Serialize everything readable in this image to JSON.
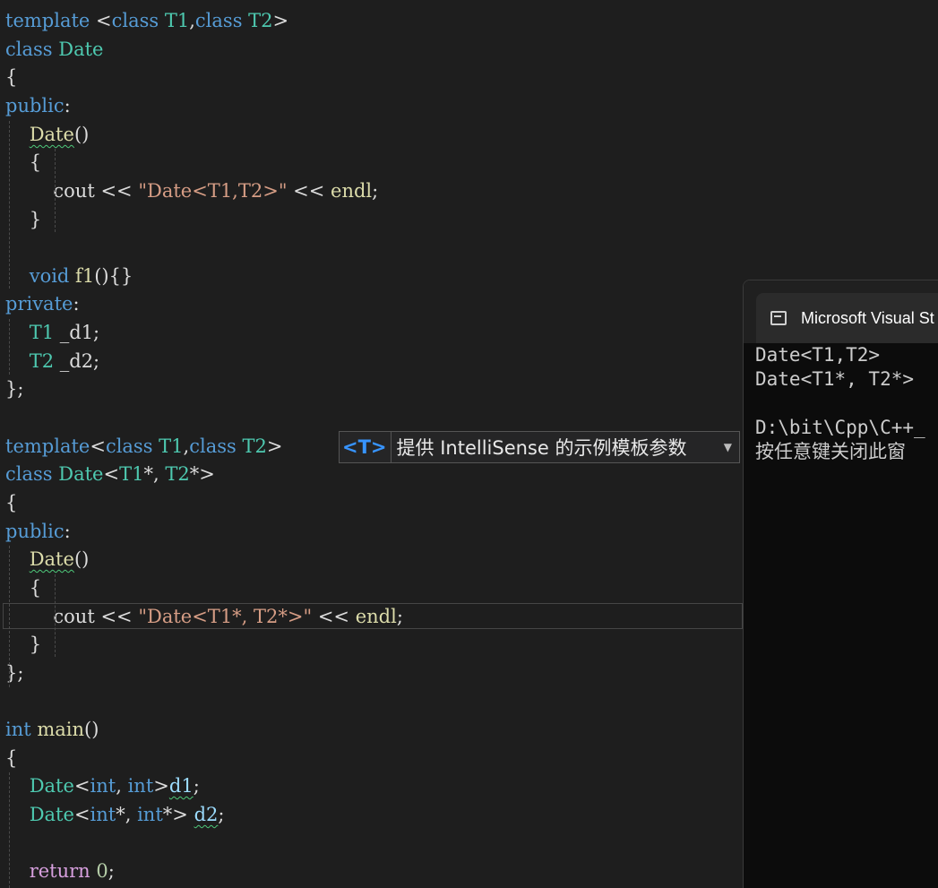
{
  "editor": {
    "lines": [
      [
        {
          "t": "template ",
          "c": "kw"
        },
        {
          "t": "<",
          "c": "pl"
        },
        {
          "t": "class ",
          "c": "kw"
        },
        {
          "t": "T1",
          "c": "ty"
        },
        {
          "t": ",",
          "c": "pl"
        },
        {
          "t": "class ",
          "c": "kw"
        },
        {
          "t": "T2",
          "c": "ty"
        },
        {
          "t": ">",
          "c": "pl"
        }
      ],
      [
        {
          "t": "class ",
          "c": "kw"
        },
        {
          "t": "Date",
          "c": "ty"
        }
      ],
      [
        {
          "t": "{",
          "c": "pl"
        }
      ],
      [
        {
          "t": "public",
          "c": "kw"
        },
        {
          "t": ":",
          "c": "pl"
        }
      ],
      [
        {
          "t": "    ",
          "c": "pl"
        },
        {
          "t": "Date",
          "c": "fn",
          "sq": true
        },
        {
          "t": "()",
          "c": "pl"
        }
      ],
      [
        {
          "t": "    {",
          "c": "pl"
        }
      ],
      [
        {
          "t": "        cout ",
          "c": "pl"
        },
        {
          "t": "<< ",
          "c": "pl"
        },
        {
          "t": "\"Date<T1,T2>\"",
          "c": "st"
        },
        {
          "t": " << ",
          "c": "pl"
        },
        {
          "t": "endl",
          "c": "fn"
        },
        {
          "t": ";",
          "c": "pl"
        }
      ],
      [
        {
          "t": "    }",
          "c": "pl"
        }
      ],
      [],
      [
        {
          "t": "    ",
          "c": "pl"
        },
        {
          "t": "void ",
          "c": "kw"
        },
        {
          "t": "f1",
          "c": "fn"
        },
        {
          "t": "(){}",
          "c": "pl"
        }
      ],
      [
        {
          "t": "private",
          "c": "kw"
        },
        {
          "t": ":",
          "c": "pl"
        }
      ],
      [
        {
          "t": "    ",
          "c": "pl"
        },
        {
          "t": "T1",
          "c": "ty"
        },
        {
          "t": " _d1;",
          "c": "pl"
        }
      ],
      [
        {
          "t": "    ",
          "c": "pl"
        },
        {
          "t": "T2",
          "c": "ty"
        },
        {
          "t": " _d2;",
          "c": "pl"
        }
      ],
      [
        {
          "t": "};",
          "c": "pl"
        }
      ],
      [],
      [
        {
          "t": "template",
          "c": "kw"
        },
        {
          "t": "<",
          "c": "pl"
        },
        {
          "t": "class ",
          "c": "kw"
        },
        {
          "t": "T1",
          "c": "ty"
        },
        {
          "t": ",",
          "c": "pl"
        },
        {
          "t": "class ",
          "c": "kw"
        },
        {
          "t": "T2",
          "c": "ty"
        },
        {
          "t": ">",
          "c": "pl"
        }
      ],
      [
        {
          "t": "class ",
          "c": "kw"
        },
        {
          "t": "Date",
          "c": "ty"
        },
        {
          "t": "<",
          "c": "pl"
        },
        {
          "t": "T1",
          "c": "ty"
        },
        {
          "t": "*, ",
          "c": "pl"
        },
        {
          "t": "T2",
          "c": "ty"
        },
        {
          "t": "*>",
          "c": "pl"
        }
      ],
      [
        {
          "t": "{",
          "c": "pl"
        }
      ],
      [
        {
          "t": "public",
          "c": "kw"
        },
        {
          "t": ":",
          "c": "pl"
        }
      ],
      [
        {
          "t": "    ",
          "c": "pl"
        },
        {
          "t": "Date",
          "c": "fn",
          "sq": true
        },
        {
          "t": "()",
          "c": "pl"
        }
      ],
      [
        {
          "t": "    {",
          "c": "pl"
        }
      ],
      [
        {
          "t": "        cout ",
          "c": "pl"
        },
        {
          "t": "<< ",
          "c": "pl"
        },
        {
          "t": "\"Date<T1*, T2*>\"",
          "c": "st"
        },
        {
          "t": " << ",
          "c": "pl"
        },
        {
          "t": "endl",
          "c": "fn"
        },
        {
          "t": ";",
          "c": "pl"
        }
      ],
      [
        {
          "t": "    }",
          "c": "pl"
        }
      ],
      [
        {
          "t": "};",
          "c": "pl"
        }
      ],
      [],
      [
        {
          "t": "int ",
          "c": "kw"
        },
        {
          "t": "main",
          "c": "fn"
        },
        {
          "t": "()",
          "c": "pl"
        }
      ],
      [
        {
          "t": "{",
          "c": "pl"
        }
      ],
      [
        {
          "t": "    ",
          "c": "pl"
        },
        {
          "t": "Date",
          "c": "ty"
        },
        {
          "t": "<",
          "c": "pl"
        },
        {
          "t": "int",
          "c": "kw"
        },
        {
          "t": ", ",
          "c": "pl"
        },
        {
          "t": "int",
          "c": "kw"
        },
        {
          "t": ">",
          "c": "pl"
        },
        {
          "t": "d1",
          "c": "vr",
          "sq": true
        },
        {
          "t": ";",
          "c": "pl"
        }
      ],
      [
        {
          "t": "    ",
          "c": "pl"
        },
        {
          "t": "Date",
          "c": "ty"
        },
        {
          "t": "<",
          "c": "pl"
        },
        {
          "t": "int",
          "c": "kw"
        },
        {
          "t": "*, ",
          "c": "pl"
        },
        {
          "t": "int",
          "c": "kw"
        },
        {
          "t": "*> ",
          "c": "pl"
        },
        {
          "t": "d2",
          "c": "vr",
          "sq": true
        },
        {
          "t": ";",
          "c": "pl"
        }
      ],
      [],
      [
        {
          "t": "    ",
          "c": "pl"
        },
        {
          "t": "return ",
          "c": "ac"
        },
        {
          "t": "0",
          "c": "nu"
        },
        {
          "t": ";",
          "c": "pl"
        }
      ]
    ]
  },
  "intellisense_hint": {
    "badge": "<T>",
    "message": "提供 IntelliSense 的示例模板参数"
  },
  "console": {
    "title": "Microsoft Visual St",
    "output": [
      "Date<T1,T2>",
      "Date<T1*, T2*>",
      "",
      "D:\\bit\\Cpp\\C++_",
      "按任意键关闭此窗"
    ]
  },
  "colors": {
    "background": "#1e1e1e",
    "keyword": "#569cd6",
    "type": "#4ec9b0",
    "function": "#dcdcaa",
    "string": "#d69d85",
    "control": "#d8a0df"
  }
}
